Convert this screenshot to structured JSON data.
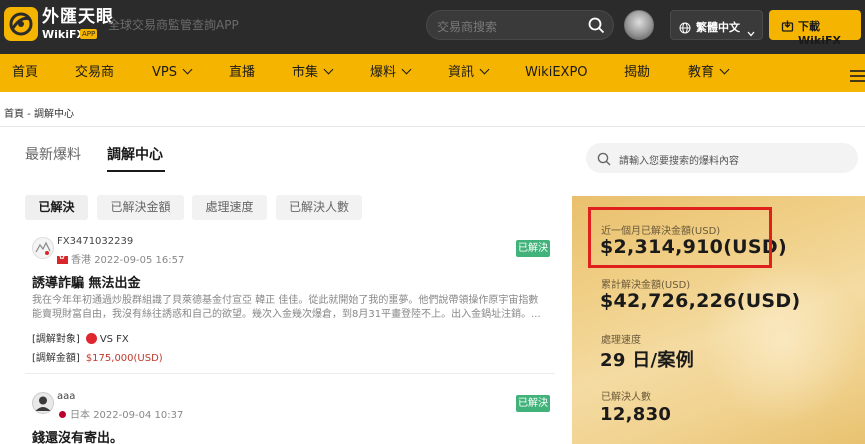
{
  "header": {
    "logo_cn": "外匯天眼",
    "logo_en": "WikiFX",
    "logo_badge": "APP",
    "tagline": "全球交易商監管查詢APP",
    "search_placeholder": "交易商搜索",
    "language": "繁體中文",
    "download_label": "下載WikiFX"
  },
  "nav": {
    "items": [
      {
        "label": "首頁",
        "dropdown": false
      },
      {
        "label": "交易商",
        "dropdown": false
      },
      {
        "label": "VPS",
        "dropdown": true
      },
      {
        "label": "直播",
        "dropdown": false
      },
      {
        "label": "市集",
        "dropdown": true
      },
      {
        "label": "爆料",
        "dropdown": true
      },
      {
        "label": "資訊",
        "dropdown": true
      },
      {
        "label": "WikiEXPO",
        "dropdown": false
      },
      {
        "label": "揭勘",
        "dropdown": false
      },
      {
        "label": "教育",
        "dropdown": true
      }
    ]
  },
  "breadcrumb": "首頁 - 調解中心",
  "tabs": {
    "latest": "最新爆料",
    "mediation": "調解中心"
  },
  "right_search_placeholder": "請輸入您要搜索的爆料內容",
  "filters": [
    "已解決",
    "已解決金額",
    "處理速度",
    "已解決人數"
  ],
  "cards": [
    {
      "user": "FX3471032239",
      "region": "香港",
      "date": "2022-09-05 16:57",
      "badge": "已解決",
      "title": "誘導詐騙 無法出金",
      "body": "我在今年年初通過炒股群組識了貝萊德基金付宣亞 韓正 佳佳。從此就開始了我的噩夢。他們說帶領操作原宇宙指數能賣現財富自由，我沒有絲往誘惑和自己的欲望。幾次入金幾次爆倉，到8月31平畫登陸不上。出入金鍋址注銷。...",
      "target_label": "[調解對象]",
      "target_value": "VS FX",
      "amount_label": "[調解金額]",
      "amount_value": "$175,000(USD)"
    },
    {
      "user": "aaa",
      "region": "日本",
      "date": "2022-09-04 10:37",
      "badge": "已解決",
      "title": "錢還沒有寄出。"
    }
  ],
  "stats": {
    "month_label": "近一個月已解決金額(USD)",
    "month_value": "$2,314,910(USD)",
    "total_label": "累計解決金額(USD)",
    "total_value": "$42,726,226(USD)",
    "speed_label": "處理速度",
    "speed_value": "29 日/案例",
    "count_label": "已解決人數",
    "count_value": "12,830"
  },
  "colors": {
    "brand_yellow": "#f5b400",
    "header_dark": "#2b2b2b",
    "resolved_green": "#41b37a",
    "highlight_red": "#e0201c"
  }
}
